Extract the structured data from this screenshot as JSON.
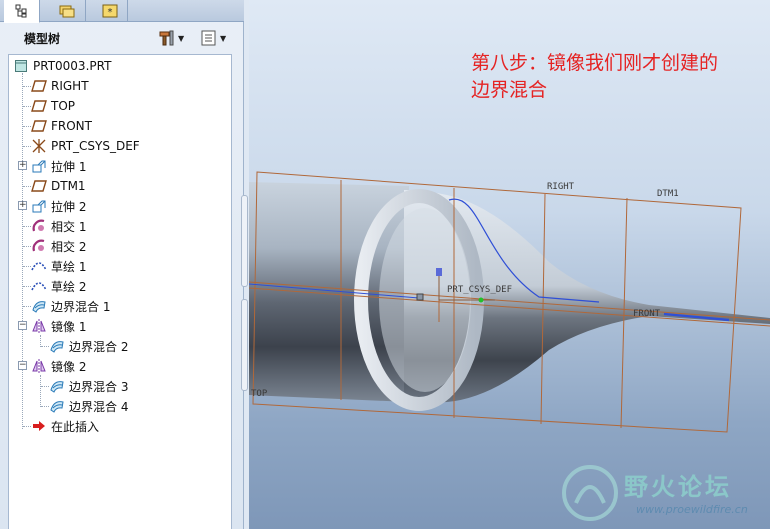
{
  "tabs": [
    {
      "icon": "model-tree-tab-icon"
    },
    {
      "icon": "folder-browser-tab-icon"
    },
    {
      "icon": "favorites-tab-icon"
    }
  ],
  "model_tree": {
    "title": "模型树",
    "settings_icon": "tools-icon",
    "show_icon": "list-icon",
    "items": [
      {
        "label": "PRT0003.PRT",
        "icon": "part-icon"
      },
      {
        "label": "RIGHT",
        "icon": "datum-plane-icon"
      },
      {
        "label": "TOP",
        "icon": "datum-plane-icon"
      },
      {
        "label": "FRONT",
        "icon": "datum-plane-icon"
      },
      {
        "label": "PRT_CSYS_DEF",
        "icon": "csys-icon"
      },
      {
        "label": "拉伸 1",
        "icon": "extrude-icon"
      },
      {
        "label": "DTM1",
        "icon": "datum-plane-icon"
      },
      {
        "label": "拉伸 2",
        "icon": "extrude-icon"
      },
      {
        "label": "相交 1",
        "icon": "intersect-icon"
      },
      {
        "label": "相交 2",
        "icon": "intersect-icon"
      },
      {
        "label": "草绘 1",
        "icon": "sketch-icon"
      },
      {
        "label": "草绘 2",
        "icon": "sketch-icon"
      },
      {
        "label": "边界混合 1",
        "icon": "boundary-blend-icon"
      },
      {
        "label": "镜像 1",
        "icon": "mirror-icon"
      },
      {
        "label": "边界混合 2",
        "icon": "boundary-blend-icon"
      },
      {
        "label": "镜像 2",
        "icon": "mirror-icon"
      },
      {
        "label": "边界混合 3",
        "icon": "boundary-blend-icon"
      },
      {
        "label": "边界混合 4",
        "icon": "boundary-blend-icon"
      },
      {
        "label": "在此插入",
        "icon": "insert-here-arrow-icon"
      }
    ]
  },
  "viewport": {
    "annotation_line1": "第八步：镜像我们刚才创建的",
    "annotation_line2": "边界混合",
    "datum_labels": {
      "right": "RIGHT",
      "dtm1": "DTM1",
      "front": "FRONT",
      "top": "TOP",
      "csys": "PRT_CSYS_DEF"
    },
    "watermark_cn": "野火论坛",
    "watermark_url": "www.proewildfire.cn",
    "colors": {
      "annotation": "#e52323",
      "datum": "#b0683a",
      "curve": "#2f4fd6"
    }
  }
}
